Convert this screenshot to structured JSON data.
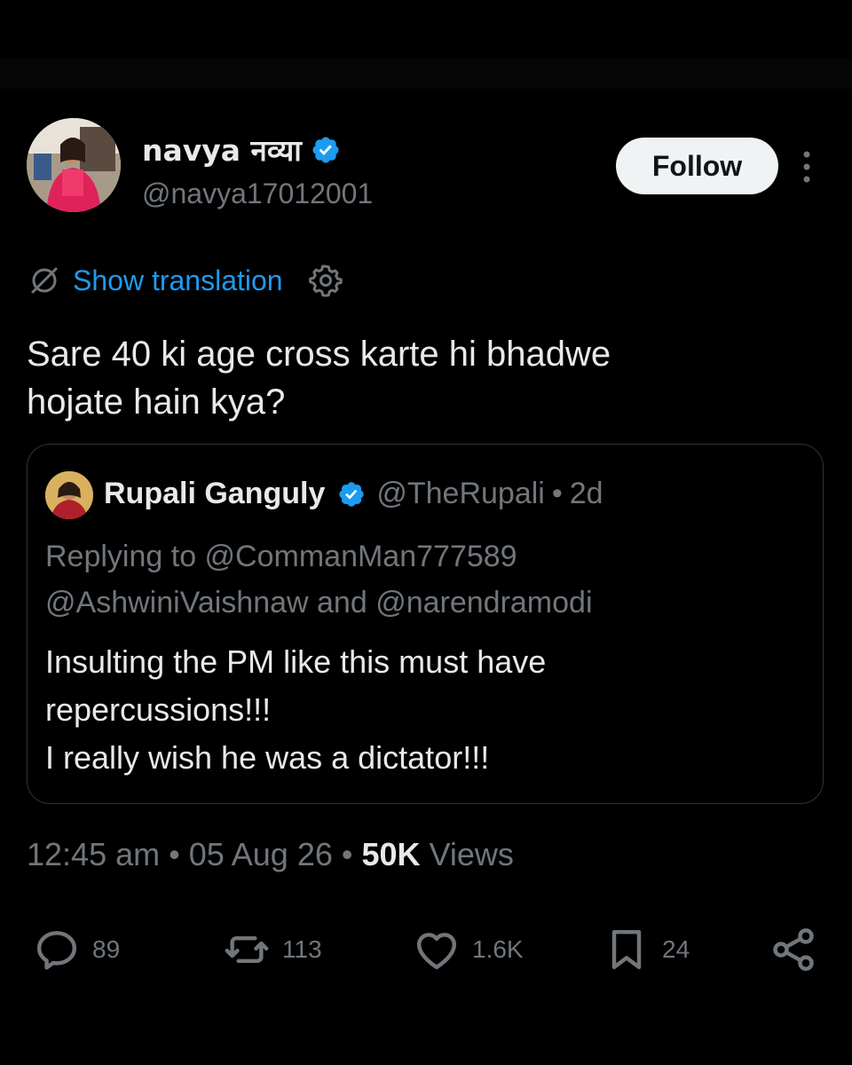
{
  "author": {
    "display_name": "navya नव्या",
    "handle": "@navya17012001",
    "verified": true,
    "follow_label": "Follow"
  },
  "translation": {
    "label": "Show translation",
    "icon": "translate-off-icon",
    "settings_icon": "gear-icon"
  },
  "tweet": {
    "text": "Sare 40 ki age cross karte hi bhadwe\nhojate hain kya?"
  },
  "quoted": {
    "display_name": "Rupali Ganguly",
    "handle": "@TheRupali",
    "separator": "•",
    "time": "2d",
    "replying_line1": "Replying to @CommanMan777589",
    "replying_line2": "@AshwiniVaishnaw and @narendramodi",
    "text": "Insulting the PM like this must have\nrepercussions!!!\nI really wish he was a dictator!!!"
  },
  "meta": {
    "time": "12:45 am",
    "sep1": "•",
    "date": "05 Aug 26",
    "sep2": "•",
    "views_count": "50K",
    "views_label": "Views"
  },
  "actions": {
    "replies": "89",
    "reposts": "113",
    "likes": "1.6K",
    "bookmarks": "24"
  },
  "colors": {
    "background": "#000000",
    "text": "#e7e9ea",
    "muted": "#71767b",
    "link": "#1d9bf0",
    "verified": "#1d9bf0",
    "border": "#2f3336",
    "follow_bg": "#eff3f4"
  }
}
